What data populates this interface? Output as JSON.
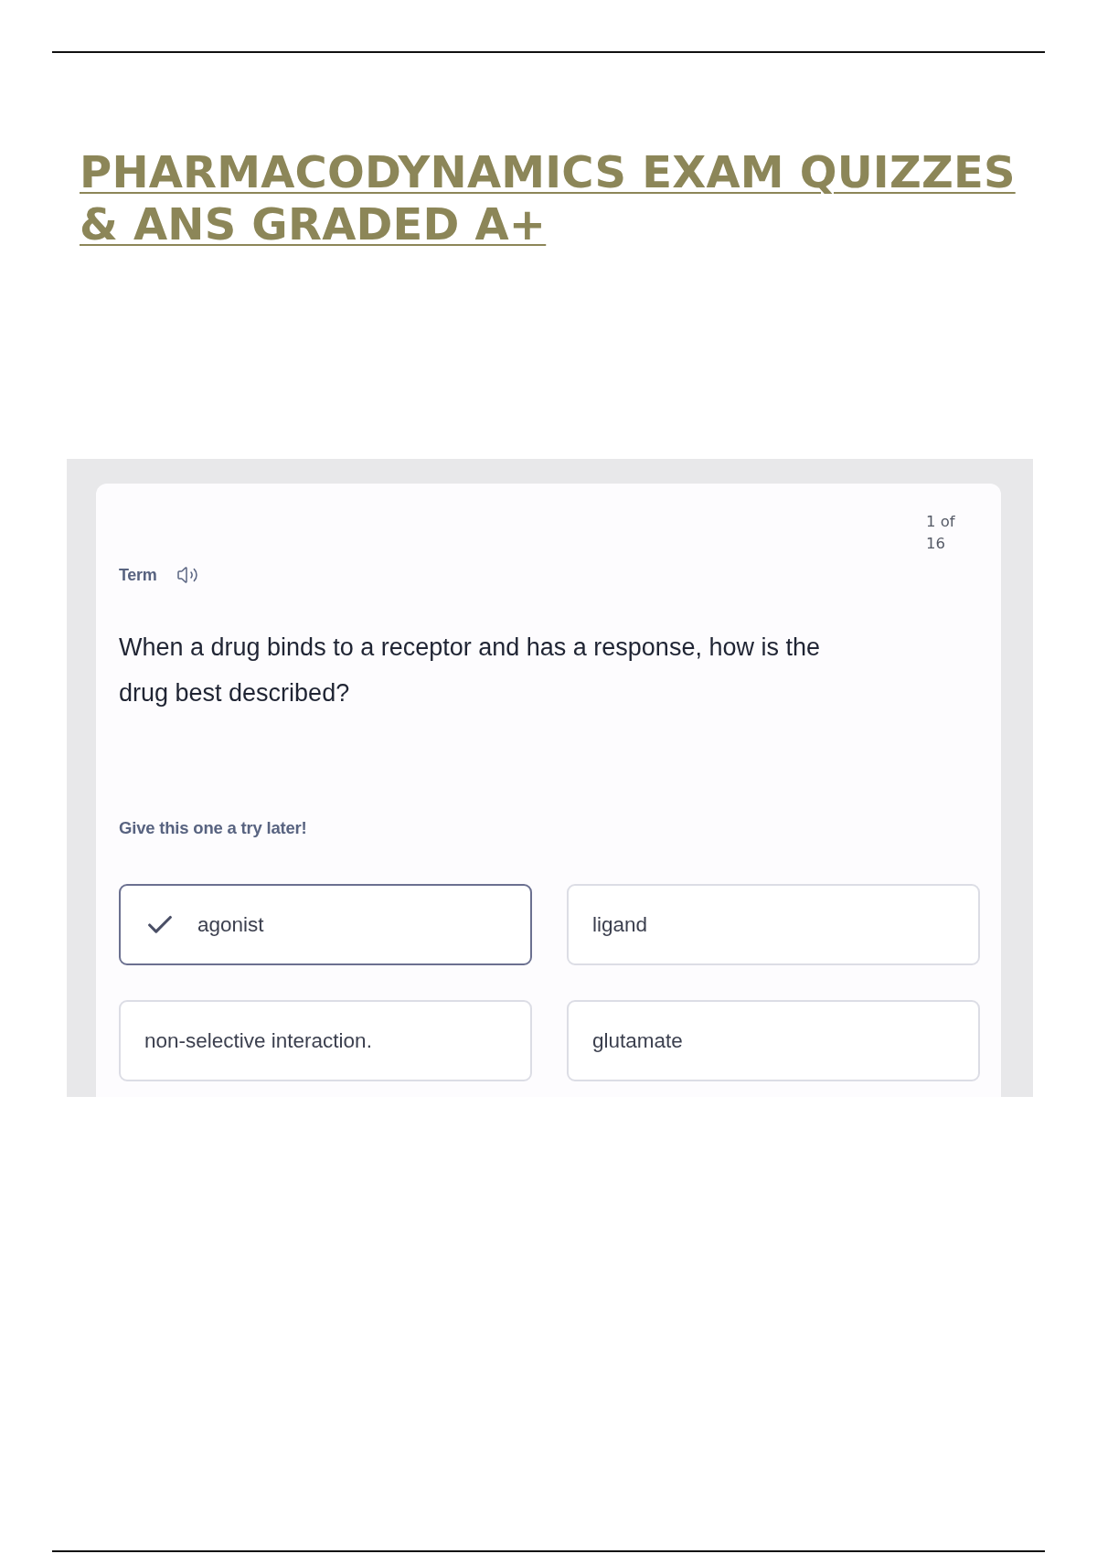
{
  "title": "PHARMACODYNAMICS EXAM QUIZZES & ANS GRADED A+",
  "card": {
    "counter": "1 of 16",
    "label": "Term",
    "question": "When a drug binds to a receptor and has a response, how is the drug best described?",
    "hint": "Give this one a try later!",
    "options": [
      {
        "text": "agonist",
        "selected": true
      },
      {
        "text": "ligand",
        "selected": false
      },
      {
        "text": "non-selective interaction.",
        "selected": false
      },
      {
        "text": "glutamate",
        "selected": false
      }
    ]
  }
}
